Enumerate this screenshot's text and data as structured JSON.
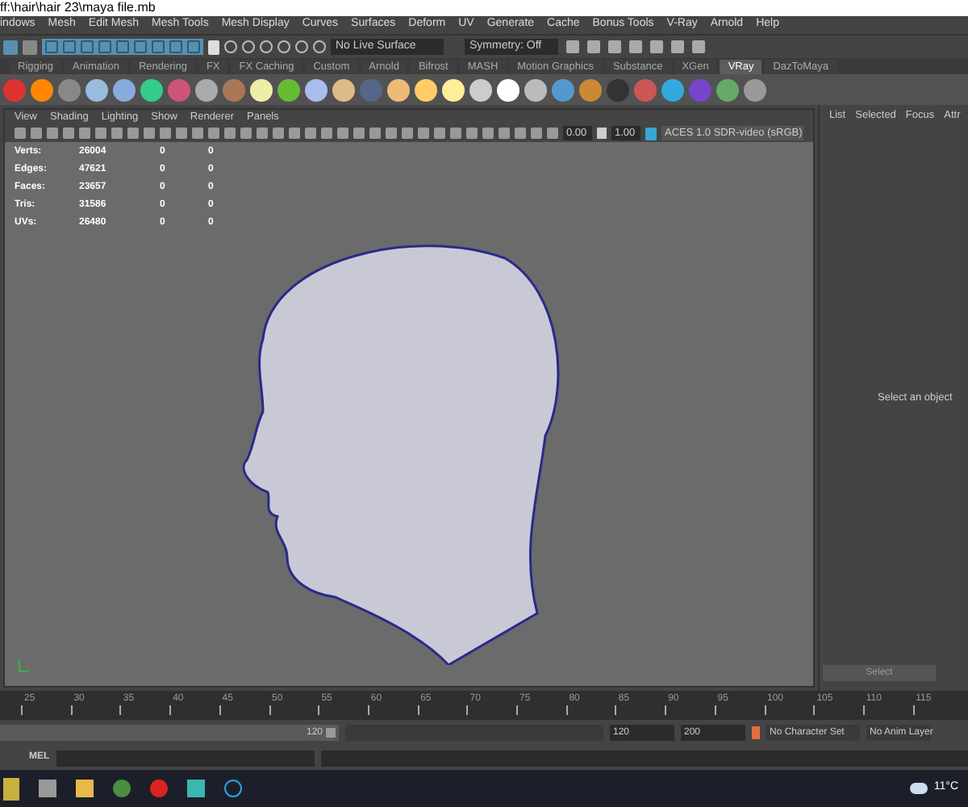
{
  "window": {
    "title": "ff:\\hair\\hair 23\\maya file.mb"
  },
  "menu_bar": [
    "indows",
    "Mesh",
    "Edit Mesh",
    "Mesh Tools",
    "Mesh Display",
    "Curves",
    "Surfaces",
    "Deform",
    "UV",
    "Generate",
    "Cache",
    "Bonus Tools",
    "V-Ray",
    "Arnold",
    "Help"
  ],
  "status_line": {
    "live_surface": "No Live Surface",
    "symmetry": "Symmetry: Off"
  },
  "shelf_tabs": [
    {
      "label": "Rigging",
      "selected": false
    },
    {
      "label": "Animation",
      "selected": false
    },
    {
      "label": "Rendering",
      "selected": false
    },
    {
      "label": "FX",
      "selected": false
    },
    {
      "label": "FX Caching",
      "selected": false
    },
    {
      "label": "Custom",
      "selected": false
    },
    {
      "label": "Arnold",
      "selected": false
    },
    {
      "label": "Bifrost",
      "selected": false
    },
    {
      "label": "MASH",
      "selected": false
    },
    {
      "label": "Motion Graphics",
      "selected": false
    },
    {
      "label": "Substance",
      "selected": false
    },
    {
      "label": "XGen",
      "selected": false
    },
    {
      "label": "VRay",
      "selected": true
    },
    {
      "label": "DazToMaya",
      "selected": false
    }
  ],
  "viewport": {
    "menu": [
      "View",
      "Shading",
      "Lighting",
      "Show",
      "Renderer",
      "Panels"
    ],
    "exposure": "0.00",
    "gamma": "1.00",
    "color_space": "ACES 1.0 SDR-video (sRGB)",
    "stats": [
      [
        "Verts:",
        "26004",
        "0",
        "0"
      ],
      [
        "Edges:",
        "47621",
        "0",
        "0"
      ],
      [
        "Faces:",
        "23657",
        "0",
        "0"
      ],
      [
        "Tris:",
        "31586",
        "0",
        "0"
      ],
      [
        "UVs:",
        "26480",
        "0",
        "0"
      ]
    ]
  },
  "channel_box": {
    "tabs": [
      "List",
      "Selected",
      "Focus",
      "Attr"
    ],
    "message": "Select an object",
    "button": "Select"
  },
  "timeline": {
    "ticks": [
      "25",
      "30",
      "35",
      "40",
      "45",
      "50",
      "55",
      "60",
      "65",
      "70",
      "75",
      "80",
      "85",
      "90",
      "95",
      "100",
      "105",
      "110",
      "115"
    ]
  },
  "range": {
    "level": 1,
    "slider_end": "120",
    "end": "120",
    "max": "200",
    "character_set": "No Character Set",
    "anim_layer": "No Anim Layer"
  },
  "command_line": {
    "label": "MEL"
  },
  "taskbar": {
    "weather": "11°C"
  }
}
